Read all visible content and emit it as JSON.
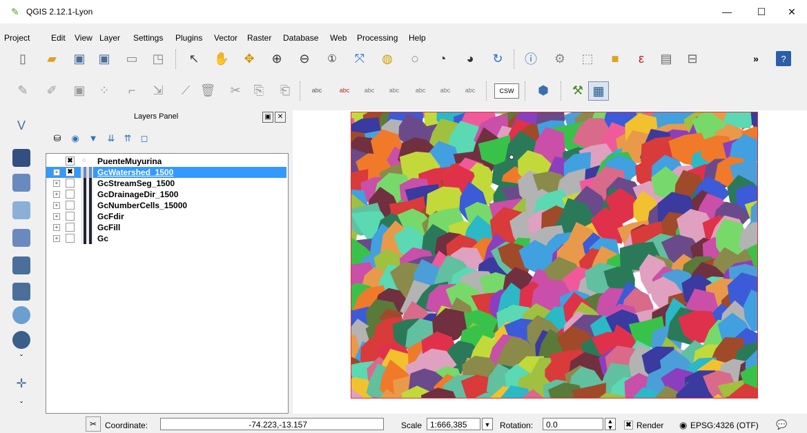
{
  "app": {
    "title": "QGIS 2.12.1-Lyon"
  },
  "window_controls": {
    "minimize": "—",
    "maximize": "☐",
    "close": "✕"
  },
  "menu": [
    "Project",
    "Edit",
    "View",
    "Layer",
    "Settings",
    "Plugins",
    "Vector",
    "Raster",
    "Database",
    "Web",
    "Processing",
    "Help"
  ],
  "toolbar": {
    "overflow": "»",
    "help": "?"
  },
  "labels_toolbar": {
    "csw": "CSW",
    "abc": "abc"
  },
  "layers_panel": {
    "title": "Layers Panel",
    "layers": [
      {
        "name": "PuenteMuyurina",
        "checked": true,
        "type": "vector",
        "expander": ""
      },
      {
        "name": "GcWatershed_1500",
        "checked": true,
        "selected": true,
        "type": "raster",
        "expander": "+"
      },
      {
        "name": "GcStreamSeg_1500",
        "checked": false,
        "type": "raster",
        "expander": "+"
      },
      {
        "name": "GcDrainageDir_1500",
        "checked": false,
        "type": "raster",
        "expander": "+"
      },
      {
        "name": "GcNumberCells_15000",
        "checked": false,
        "type": "raster",
        "expander": "+"
      },
      {
        "name": "GcFdir",
        "checked": false,
        "type": "raster",
        "expander": "+"
      },
      {
        "name": "GcFill",
        "checked": false,
        "type": "raster",
        "expander": "+"
      },
      {
        "name": "Gc",
        "checked": false,
        "type": "raster",
        "expander": "+"
      }
    ]
  },
  "statusbar": {
    "coordinate_label": "Coordinate:",
    "coordinate_value": "-74.223,-13.157",
    "scale_label": "Scale",
    "scale_value": "1:666,385",
    "rotation_label": "Rotation:",
    "rotation_value": "0.0",
    "render_label": "Render",
    "crs": "EPSG:4326 (OTF)"
  },
  "colors": {
    "selection": "#3399ff",
    "map_border": "#e03030"
  }
}
